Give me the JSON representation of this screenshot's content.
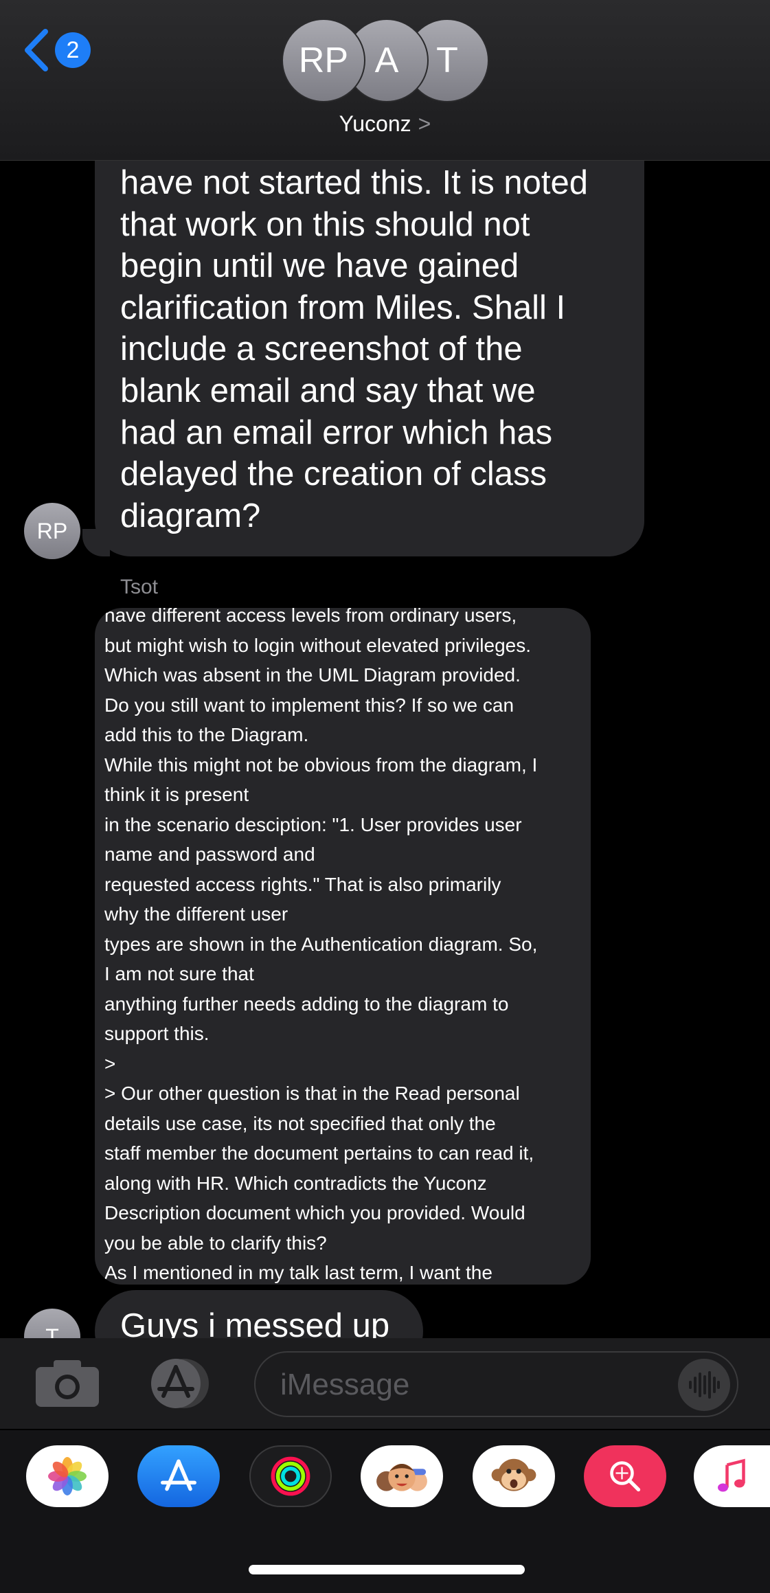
{
  "header": {
    "back_badge": "2",
    "avatars": [
      "RP",
      "A",
      "T"
    ],
    "group_name": "Yuconz",
    "chevron": ">"
  },
  "messages": [
    {
      "sender_initials": "RP",
      "partial_top_line": "have not started this. It is noted",
      "text": "have not started this. It is noted\nthat work on this should not\nbegin until we have gained\nclarification from Miles. Shall I\ninclude a screenshot of the\nblank email and say that we\nhad an email error which has\ndelayed the creation of class\ndiagram?"
    },
    {
      "sender_name": "Tsot",
      "text": "have different access levels from ordinary users,\nbut might wish to login without elevated privileges.\nWhich was absent in the UML Diagram provided.\nDo you still want to implement this? If so we can\nadd this to the Diagram.\nWhile this might not be obvious from the diagram, I\nthink it is present\nin the scenario desciption: \"1. User provides user\nname and password and\nrequested access rights.\" That is also primarily\nwhy the different user\ntypes are shown in the Authentication diagram. So,\nI am not sure that\nanything further needs adding to the diagram to\nsupport this.\n>\n> Our other question is that in the Read personal\ndetails use case, its not specified that only the\nstaff member the document pertains to can read it,\nalong with HR. Which contradicts the Yuconz\nDescription document which you provided. Would\nyou be able to clarify this?\nAs I mentioned in my talk last term, I want the"
    },
    {
      "sender_initials": "T",
      "text": "Guys i messed up"
    }
  ],
  "input": {
    "placeholder": "iMessage"
  },
  "app_drawer": {
    "apps": [
      "photos-app",
      "app-store-app",
      "activity-app",
      "memoji-app",
      "animoji-app",
      "image-search-app",
      "music-app"
    ]
  },
  "colors": {
    "bubble": "#262629",
    "badge": "#1e7ef7",
    "accent": "#1e7ef7"
  }
}
